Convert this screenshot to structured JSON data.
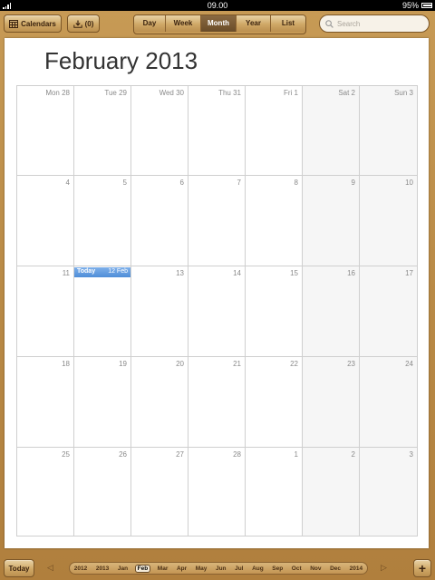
{
  "status": {
    "time": "09.00",
    "battery": "95%"
  },
  "toolbar": {
    "calendars_label": "Calendars",
    "inbox_label": "(0)",
    "views": [
      "Day",
      "Week",
      "Month",
      "Year",
      "List"
    ],
    "active_view": "Month",
    "search_placeholder": "Search"
  },
  "month_title": "February 2013",
  "weekdays": [
    "Mon 28",
    "Tue 29",
    "Wed 30",
    "Thu 31",
    "Fri 1",
    "Sat 2",
    "Sun 3"
  ],
  "weeks": [
    [
      "4",
      "5",
      "6",
      "7",
      "8",
      "9",
      "10"
    ],
    [
      "11",
      "",
      "13",
      "14",
      "15",
      "16",
      "17"
    ],
    [
      "18",
      "19",
      "20",
      "21",
      "22",
      "23",
      "24"
    ],
    [
      "25",
      "26",
      "27",
      "28",
      "1",
      "2",
      "3"
    ]
  ],
  "today": {
    "label": "Today",
    "date": "12 Feb"
  },
  "bottom": {
    "today_label": "Today",
    "add_label": "+",
    "timeline": [
      "2012",
      "2013",
      "Jan",
      "Feb",
      "Mar",
      "Apr",
      "May",
      "Jun",
      "Jul",
      "Aug",
      "Sep",
      "Oct",
      "Nov",
      "Dec",
      "2014"
    ],
    "selected": "Feb"
  },
  "colors": {
    "today_highlight": "#4e8dd8",
    "wood": "#c79a55"
  }
}
